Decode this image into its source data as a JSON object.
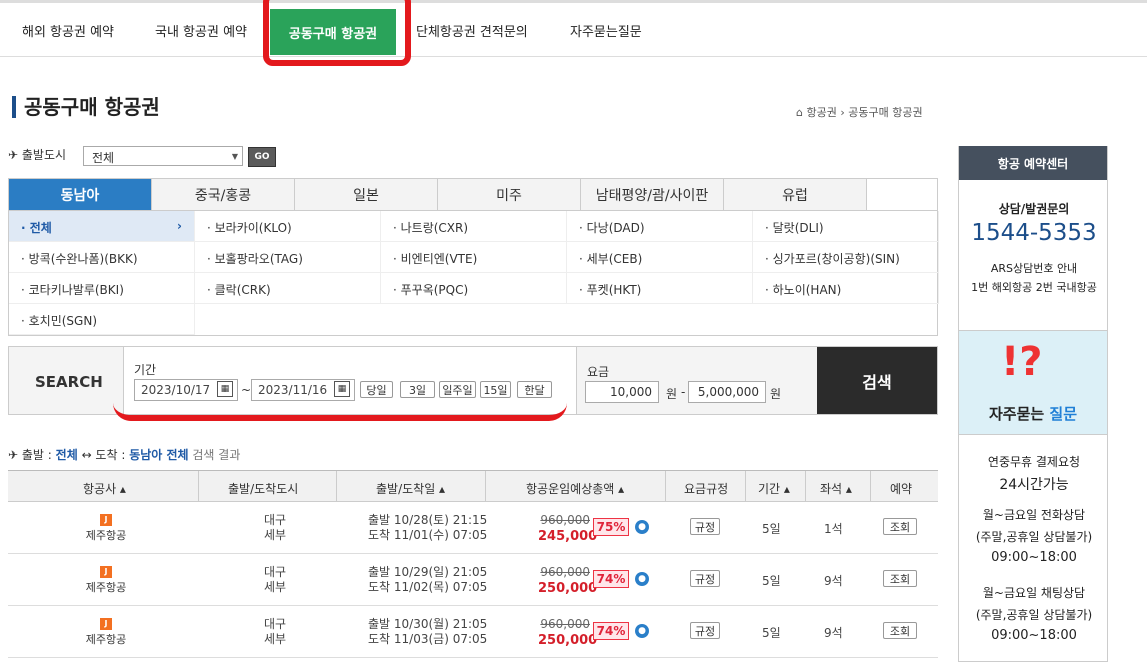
{
  "topnav": {
    "items": [
      "해외 항공권 예약",
      "국내 항공권 예약",
      "공동구매 항공권",
      "단체항공권 견적문의",
      "자주묻는질문"
    ]
  },
  "page": {
    "title": "공동구매 항공권",
    "breadcrumb": [
      "항공권",
      "공동구매 항공권"
    ]
  },
  "filter": {
    "departure_label": "출발도시",
    "departure_value": "전체",
    "go_label": "GO"
  },
  "regions": [
    "동남아",
    "중국/홍콩",
    "일본",
    "미주",
    "남태평양/괌/사이판",
    "유럽"
  ],
  "cities": [
    "· 전체",
    "· 보라카이(KLO)",
    "· 나트랑(CXR)",
    "· 다낭(DAD)",
    "· 달랏(DLI)",
    "· 방콕(수완나폼)(BKK)",
    "· 보홀팡라오(TAG)",
    "· 비엔티엔(VTE)",
    "· 세부(CEB)",
    "· 싱가포르(창이공항)(SIN)",
    "· 코타키나발루(BKI)",
    "· 클락(CRK)",
    "· 푸꾸옥(PQC)",
    "· 푸켓(HKT)",
    "· 하노이(HAN)",
    "· 호치민(SGN)"
  ],
  "search": {
    "label": "SEARCH",
    "period_label": "기간",
    "date_from": "2023/10/17",
    "date_to": "2023/11/16",
    "tilde": "~",
    "quick": [
      "당일",
      "3일",
      "일주일",
      "15일",
      "한달"
    ],
    "fare_label": "요금",
    "fare_min": "10,000",
    "fare_max": "5,000,000",
    "won": "원",
    "dash": "-",
    "button": "검색"
  },
  "summary": {
    "prefix": "출발 : ",
    "dep": "전체",
    "arrow": " ↔ 도착 : ",
    "arr": "동남아 전체",
    "suffix": " 검색 결과"
  },
  "table": {
    "headers": [
      "항공사 ▴",
      "출발/도착도시",
      "출발/도착일 ▴",
      "항공운임예상총액 ▴",
      "요금규정",
      "기간 ▴",
      "좌석 ▴",
      "예약"
    ],
    "rows": [
      {
        "airline": "제주항공",
        "dep_city": "대구",
        "arr_city": "세부",
        "dep": "출발 10/28(토) 21:15",
        "arr": "도착 11/01(수) 07:05",
        "orig": "960,000",
        "price": "245,000",
        "pct": "75%",
        "rule": "규정",
        "days": "5일",
        "seats": "1석",
        "book": "조회"
      },
      {
        "airline": "제주항공",
        "dep_city": "대구",
        "arr_city": "세부",
        "dep": "출발 10/29(일) 21:05",
        "arr": "도착 11/02(목) 07:05",
        "orig": "960,000",
        "price": "250,000",
        "pct": "74%",
        "rule": "규정",
        "days": "5일",
        "seats": "9석",
        "book": "조회"
      },
      {
        "airline": "제주항공",
        "dep_city": "대구",
        "arr_city": "세부",
        "dep": "출발 10/30(월) 21:05",
        "arr": "도착 11/03(금) 07:05",
        "orig": "960,000",
        "price": "250,000",
        "pct": "74%",
        "rule": "규정",
        "days": "5일",
        "seats": "9석",
        "book": "조회"
      }
    ]
  },
  "side": {
    "head": "항공 예약센터",
    "consult": "상담/발권문의",
    "phone": "1544-5353",
    "ars": "ARS상담번호 안내",
    "ars_detail": "1번 해외항공 2번 국내항공",
    "faq_prefix": "자주묻는 ",
    "faq_suffix": "질문",
    "l1": "연중무휴 결제요청",
    "l2": "24시간가능",
    "l3": "월~금요일 전화상담",
    "l4": "(주말,공휴일 상담불가)",
    "l5": "09:00~18:00",
    "l6": "월~금요일 채팅상담",
    "l7": "(주말,공휴일 상담불가)",
    "l8": "09:00~18:00"
  }
}
